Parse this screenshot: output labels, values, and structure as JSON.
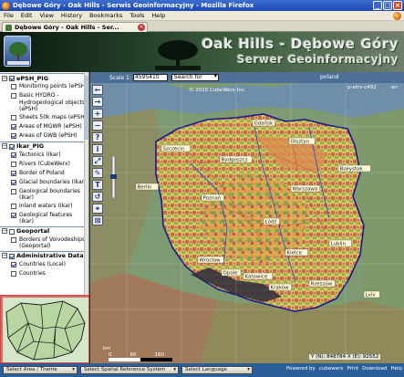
{
  "window": {
    "title": "Dębowe Góry - Oak Hills - Serwis Geoinformacyjny - Mozilla Firefox",
    "buttons": [
      "_",
      "□",
      "×"
    ]
  },
  "menu": [
    "File",
    "Edit",
    "View",
    "History",
    "Bookmarks",
    "Tools",
    "Help"
  ],
  "tab": {
    "label": "Dębowe Góry - Oak Hills - Ser...",
    "close": "×"
  },
  "banner": {
    "title_line1": "Oak Hills - Dębowe Góry",
    "title_line2": "Serwer Geoinformacyjny"
  },
  "layers": {
    "groups": [
      {
        "name": "ePSH_PIG",
        "expanded": true,
        "checked": true,
        "items": [
          {
            "label": "Monitoring points (ePSH)",
            "checked": false
          },
          {
            "label": "Basic HYDRO - Hydrogeological objects (ePSH)",
            "checked": false
          },
          {
            "label": "Sheets 50k maps (ePSH)",
            "checked": false
          },
          {
            "label": "Areas of MGWR (ePSH)",
            "checked": true
          },
          {
            "label": "Areas of GWB (ePSH)",
            "checked": true
          }
        ]
      },
      {
        "name": "Ikar_PIG",
        "expanded": true,
        "checked": true,
        "items": [
          {
            "label": "Tectonics (Ikar)",
            "checked": true
          },
          {
            "label": "Rivers (CubeWerx)",
            "checked": false
          },
          {
            "label": "Border of Poland",
            "checked": true
          },
          {
            "label": "Glacial boundaries (Ikar)",
            "checked": true
          },
          {
            "label": "Geological boundaries (Ikar)",
            "checked": false
          },
          {
            "label": "Inland waters (Ikar)",
            "checked": false
          },
          {
            "label": "Geological features (Ikar)",
            "checked": true
          }
        ]
      },
      {
        "name": "Geoportal",
        "expanded": true,
        "checked": false,
        "items": [
          {
            "label": "Borders of Voivodeships (Geoportal)",
            "checked": false
          }
        ]
      },
      {
        "name": "Administrative Data",
        "expanded": true,
        "checked": true,
        "items": [
          {
            "label": "Countries (Local)",
            "checked": true
          },
          {
            "label": "Countries",
            "checked": false
          }
        ]
      }
    ]
  },
  "map": {
    "scale_label": "Scale 1:",
    "scale_value": "4595410",
    "search_placeholder": "Search for",
    "country": "poland",
    "crs": "p-etrs-c492",
    "language": "en",
    "copyright": "© 2010 CubeWerx Inc.",
    "scalebar": {
      "unit": "km",
      "ticks": [
        "0",
        "80",
        "160"
      ]
    },
    "coords": "Y (N): 848784   X (E): 92552",
    "cities": [
      "Gdańsk",
      "Szczecin",
      "Bydgoszcz",
      "Poznań",
      "Warszawa",
      "Łódź",
      "Wrocław",
      "Kraków",
      "Katowice",
      "Lublin",
      "Rzeszów",
      "Opole",
      "Kielce",
      "Berlin",
      "Lviv",
      "Olsztyn",
      "Białystok"
    ],
    "tools": [
      "←",
      "→",
      "+",
      "−",
      "?",
      "i",
      "⤢",
      "✎",
      "T",
      "↺",
      "⌖",
      "⊠"
    ]
  },
  "bottom": {
    "select_area": "Select Area / Theme",
    "select_srs": "Select Spatial Reference System",
    "select_lang": "Select Language",
    "links": [
      "Powered by",
      "cubewerx",
      "Print",
      "Download",
      "Help"
    ]
  },
  "colors": {
    "titlebar": "#1b47b5",
    "bottombar": "#2a5f9a",
    "map_sea": "#6e8aa8",
    "border_red": "#d44"
  }
}
